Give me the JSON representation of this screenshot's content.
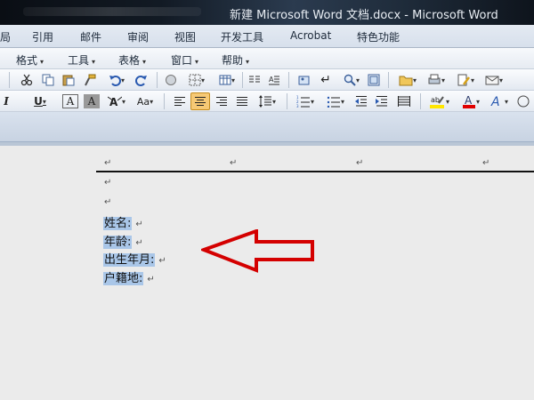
{
  "window": {
    "title": "新建 Microsoft Word 文档.docx - Microsoft Word"
  },
  "ribbon_tabs": [
    "局",
    "引用",
    "邮件",
    "审阅",
    "视图",
    "开发工具",
    "Acrobat",
    "特色功能"
  ],
  "menu_bar": [
    "格式",
    "工具",
    "表格",
    "窗口",
    "帮助"
  ],
  "toolbar_row2": {
    "italic": "I",
    "underline": "U",
    "font_a": "A",
    "font_a_shaded": "A",
    "change_case": "Aa"
  },
  "document": {
    "paragraph_mark": "↵",
    "lines": [
      {
        "text": "姓名:"
      },
      {
        "text": "年龄:"
      },
      {
        "text": "出生年月:"
      },
      {
        "text": "户籍地:"
      }
    ]
  },
  "colors": {
    "selection": "#a9c6e8",
    "arrow": "#d40000",
    "highlight": "#ffe600",
    "font_color": "#e00000"
  },
  "icons": [
    "cut-icon",
    "copy-icon",
    "paste-icon",
    "format-painter-icon",
    "undo-icon",
    "redo-icon",
    "table-icon",
    "columns-icon",
    "zoom-icon",
    "folder-icon",
    "align-left-icon",
    "align-center-icon",
    "align-right-icon",
    "justify-icon",
    "line-spacing-icon",
    "numbering-icon",
    "bullets-icon",
    "decrease-indent-icon",
    "increase-indent-icon",
    "highlight-icon",
    "font-color-icon"
  ]
}
